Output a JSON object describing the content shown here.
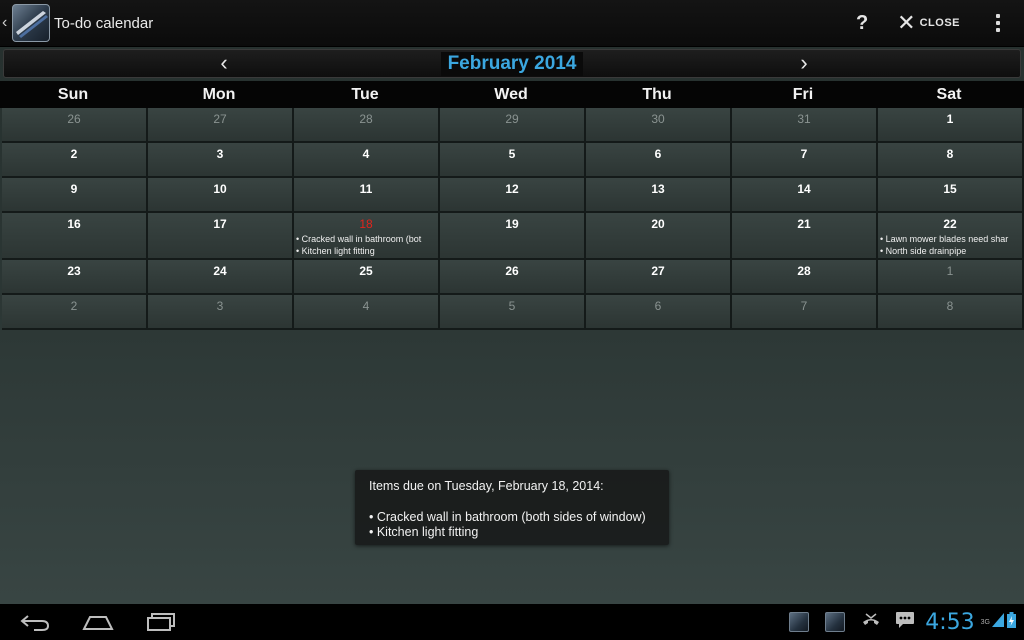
{
  "app": {
    "title": "To-do calendar",
    "icons": {
      "up": "chevron-left-icon",
      "logo": "app-logo-icon"
    }
  },
  "actions": {
    "help": "?",
    "close_label": "CLOSE",
    "close_icon": "close-icon",
    "overflow_icon": "overflow-menu-icon"
  },
  "calendar": {
    "month_title": "February 2014",
    "prev_icon": "chevron-left-icon",
    "next_icon": "chevron-right-icon",
    "weekdays": [
      "Sun",
      "Mon",
      "Tue",
      "Wed",
      "Thu",
      "Fri",
      "Sat"
    ],
    "weeks": [
      [
        {
          "day": "26",
          "state": "dim"
        },
        {
          "day": "27",
          "state": "dim"
        },
        {
          "day": "28",
          "state": "dim"
        },
        {
          "day": "29",
          "state": "dim"
        },
        {
          "day": "30",
          "state": "dim"
        },
        {
          "day": "31",
          "state": "dim"
        },
        {
          "day": "1",
          "state": "normal"
        }
      ],
      [
        {
          "day": "2",
          "state": "normal"
        },
        {
          "day": "3",
          "state": "normal"
        },
        {
          "day": "4",
          "state": "normal"
        },
        {
          "day": "5",
          "state": "normal"
        },
        {
          "day": "6",
          "state": "normal"
        },
        {
          "day": "7",
          "state": "normal"
        },
        {
          "day": "8",
          "state": "normal"
        }
      ],
      [
        {
          "day": "9",
          "state": "normal"
        },
        {
          "day": "10",
          "state": "normal"
        },
        {
          "day": "11",
          "state": "normal"
        },
        {
          "day": "12",
          "state": "normal"
        },
        {
          "day": "13",
          "state": "normal"
        },
        {
          "day": "14",
          "state": "normal"
        },
        {
          "day": "15",
          "state": "normal"
        }
      ],
      [
        {
          "day": "16",
          "state": "normal"
        },
        {
          "day": "17",
          "state": "normal"
        },
        {
          "day": "18",
          "state": "today",
          "items": [
            "• Cracked wall in bathroom (bot",
            "• Kitchen light fitting"
          ]
        },
        {
          "day": "19",
          "state": "normal"
        },
        {
          "day": "20",
          "state": "normal"
        },
        {
          "day": "21",
          "state": "normal"
        },
        {
          "day": "22",
          "state": "normal",
          "items": [
            "• Lawn mower blades need shar",
            "• North side drainpipe"
          ]
        }
      ],
      [
        {
          "day": "23",
          "state": "normal"
        },
        {
          "day": "24",
          "state": "normal"
        },
        {
          "day": "25",
          "state": "normal"
        },
        {
          "day": "26",
          "state": "normal"
        },
        {
          "day": "27",
          "state": "normal"
        },
        {
          "day": "28",
          "state": "normal"
        },
        {
          "day": "1",
          "state": "dim"
        }
      ],
      [
        {
          "day": "2",
          "state": "dim"
        },
        {
          "day": "3",
          "state": "dim"
        },
        {
          "day": "4",
          "state": "dim"
        },
        {
          "day": "5",
          "state": "dim"
        },
        {
          "day": "6",
          "state": "dim"
        },
        {
          "day": "7",
          "state": "dim"
        },
        {
          "day": "8",
          "state": "dim"
        }
      ]
    ]
  },
  "toast": {
    "heading": "Items due on Tuesday, February 18, 2014:",
    "lines": [
      "• Cracked wall in bathroom (both sides of window)",
      "• Kitchen light fitting"
    ]
  },
  "system_bar": {
    "buttons": [
      "back-icon",
      "home-icon",
      "recent-apps-icon"
    ],
    "notifications": [
      "app-notification-icon",
      "app-notification-icon",
      "missed-call-icon",
      "message-icon"
    ],
    "clock": "4:53",
    "network": "3G",
    "colors": {
      "accent": "#3ba7e0",
      "today": "#e0241c"
    }
  }
}
